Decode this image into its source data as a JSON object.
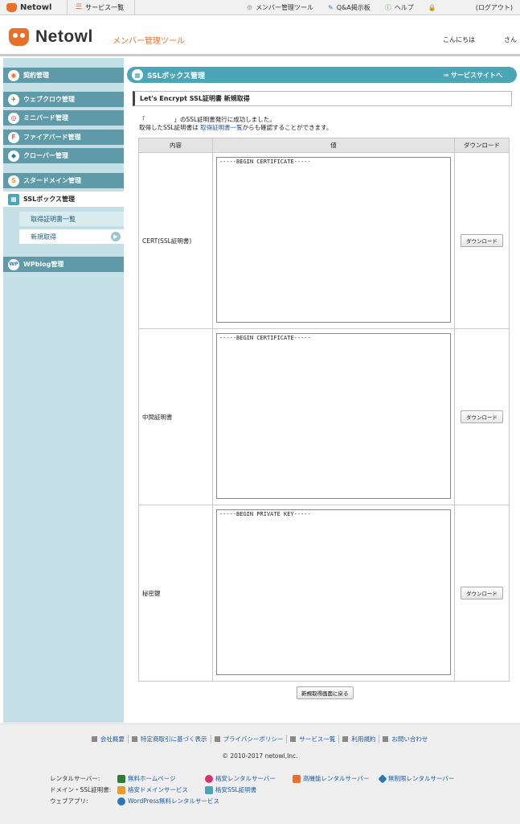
{
  "topbar": {
    "logo": "Netowl",
    "services": "サービス一覧",
    "member_tool": "メンバー管理ツール",
    "qa": "Q&A掲示板",
    "help": "ヘルプ",
    "logout": "(ログアウト)"
  },
  "header": {
    "brand": "Netowl",
    "subtitle": "メンバー管理ツール",
    "greeting": "こんにちは",
    "honorific": "さん"
  },
  "sidebar": {
    "items": [
      {
        "label": "契約管理"
      },
      {
        "label": "ウェブクロウ管理"
      },
      {
        "label": "ミニバード管理"
      },
      {
        "label": "ファイアバード管理"
      },
      {
        "label": "クローバー管理"
      },
      {
        "label": "スタードメイン管理"
      },
      {
        "label": "SSLボックス管理"
      },
      {
        "label": "WPblog管理"
      }
    ],
    "sub": [
      {
        "label": "取得証明書一覧"
      },
      {
        "label": "新規取得"
      }
    ]
  },
  "main": {
    "section_title": "SSLボックス管理",
    "service_site_link": "⇒ サービスサイトへ",
    "page_title": "Let's Encrypt SSL証明書 新規取得",
    "msg_open": "「",
    "msg_line1": "」のSSL証明書発行に成功しました。",
    "msg_line2_pre": "取得したSSL証明書は ",
    "msg_line2_link": "取得証明書一覧",
    "msg_line2_post": "からも確認することができます。",
    "table": {
      "headers": [
        "内容",
        "値",
        "ダウンロード"
      ],
      "rows": [
        {
          "label": "CERT(SSL証明書)",
          "value": "-----BEGIN CERTIFICATE-----",
          "button": "ダウンロード"
        },
        {
          "label": "中間証明書",
          "value": "-----BEGIN CERTIFICATE-----",
          "button": "ダウンロード"
        },
        {
          "label": "秘密鍵",
          "value": "-----BEGIN PRIVATE KEY-----",
          "button": "ダウンロード"
        }
      ]
    },
    "back_button": "新規取得画面に戻る"
  },
  "footer": {
    "links": [
      "会社概要",
      "特定商取引に基づく表示",
      "プライバシーポリシー",
      "サービス一覧",
      "利用規約",
      "お問い合わせ"
    ],
    "copyright": "© 2010-2017 netowl,Inc.",
    "rental_label": "レンタルサーバー:",
    "domain_label": "ドメイン・SSL証明書:",
    "webapp_label": "ウェブアプリ:",
    "rental": [
      "無料ホームページ",
      "格安レンタルサーバー",
      "高機能レンタルサーバー",
      "無制限レンタルサーバー"
    ],
    "domain": [
      "格安ドメインサービス",
      "格安SSL証明書"
    ],
    "webapp": [
      "WordPress無料レンタルサービス"
    ]
  },
  "colors": {
    "accent_orange": "#e8702a",
    "teal": "#4aa5b6",
    "sidebar_item": "#5f9aa8",
    "sidebar_bg": "#c4e0e6"
  }
}
